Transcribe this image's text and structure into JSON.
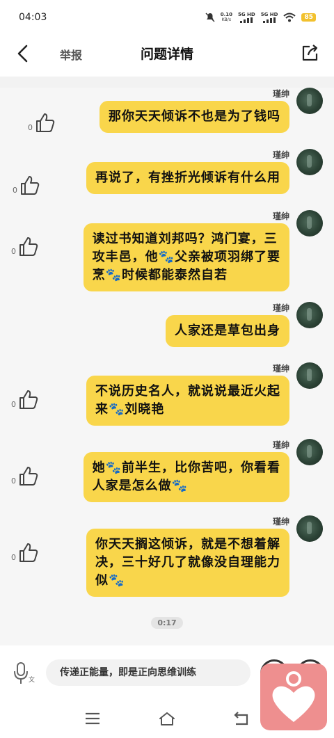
{
  "status_bar": {
    "time": "04:03",
    "net_speed_top": "0.10",
    "net_speed_unit": "KB/s",
    "sim1_label": "5G HD",
    "sim2_label": "5G HD",
    "battery": "85"
  },
  "header": {
    "report_label": "举报",
    "title": "问题详情"
  },
  "messages": [
    {
      "user": "瑾绅",
      "text": "那你天天倾诉不也是为了钱吗",
      "likes": "0"
    },
    {
      "user": "瑾绅",
      "text": "再说了，有挫折光倾诉有什么用",
      "likes": "0"
    },
    {
      "user": "瑾绅",
      "text": "读过书知道刘邦吗？鸿门宴，三\n攻丰邑，他🐾父亲被项羽绑了要\n烹🐾时候都能泰然自若",
      "likes": "0"
    },
    {
      "user": "瑾绅",
      "text": "人家还是草包出身",
      "likes": ""
    },
    {
      "user": "瑾绅",
      "text": "不说历史名人，就说说最近火起\n来🐾刘晓艳",
      "likes": "0"
    },
    {
      "user": "瑾绅",
      "text": "她🐾前半生，比你苦吧，你看看\n人家是怎么做🐾",
      "likes": "0"
    },
    {
      "user": "瑾绅",
      "text": "你天天搁这倾诉，就是不想着解\n决，三十好几了就像没自理能力\n似🐾",
      "likes": "0"
    }
  ],
  "voice_duration": "0:17",
  "input": {
    "placeholder": "传递正能量，即是正向思维训练",
    "mic_icon": "mic-translate-icon"
  },
  "colors": {
    "bubble": "#f9d64b",
    "chat_background": "#f6f6f6",
    "float_badge": "#ee8f8f"
  }
}
